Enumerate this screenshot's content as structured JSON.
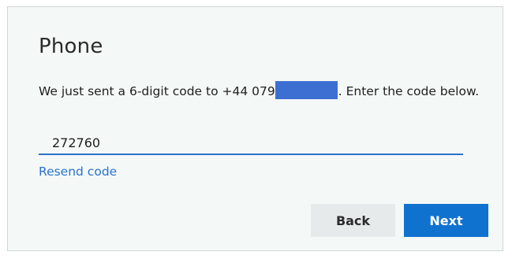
{
  "dialog": {
    "title": "Phone",
    "message_prefix": "We just sent a 6-digit code to +44 079",
    "message_suffix": ". Enter the code below.",
    "code_value": "272760",
    "resend_label": "Resend code",
    "back_label": "Back",
    "next_label": "Next"
  },
  "colors": {
    "accent": "#0f72cf",
    "link": "#2a73cc",
    "redaction": "#3d6fd2",
    "card_background": "#f4f8f6"
  }
}
